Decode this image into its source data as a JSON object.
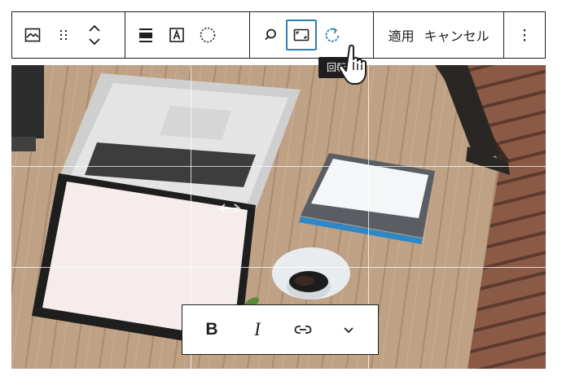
{
  "toolbar": {
    "apply_label": "適用",
    "cancel_label": "キャンセル",
    "icons": {
      "image": "image-icon",
      "drag": "drag-handle-icon",
      "move": "chevron-up-down-icon",
      "align": "align-center-icon",
      "text_overlay": "text-overlay-icon",
      "duotone": "duotone-circle-icon",
      "search": "search-icon",
      "aspect_ratio": "aspect-ratio-icon",
      "rotate": "rotate-icon",
      "more": "more-vertical-icon"
    },
    "active_tool": "aspect_ratio"
  },
  "tooltip": {
    "text": "回転"
  },
  "caption_toolbar": {
    "bold_label": "B",
    "italic_label": "I",
    "link_icon": "link-icon",
    "more_icon": "chevron-down-icon"
  },
  "colors": {
    "border": "#1e1e1e",
    "accent": "#2a83b0",
    "tooltip_bg": "#1e1e1e"
  }
}
